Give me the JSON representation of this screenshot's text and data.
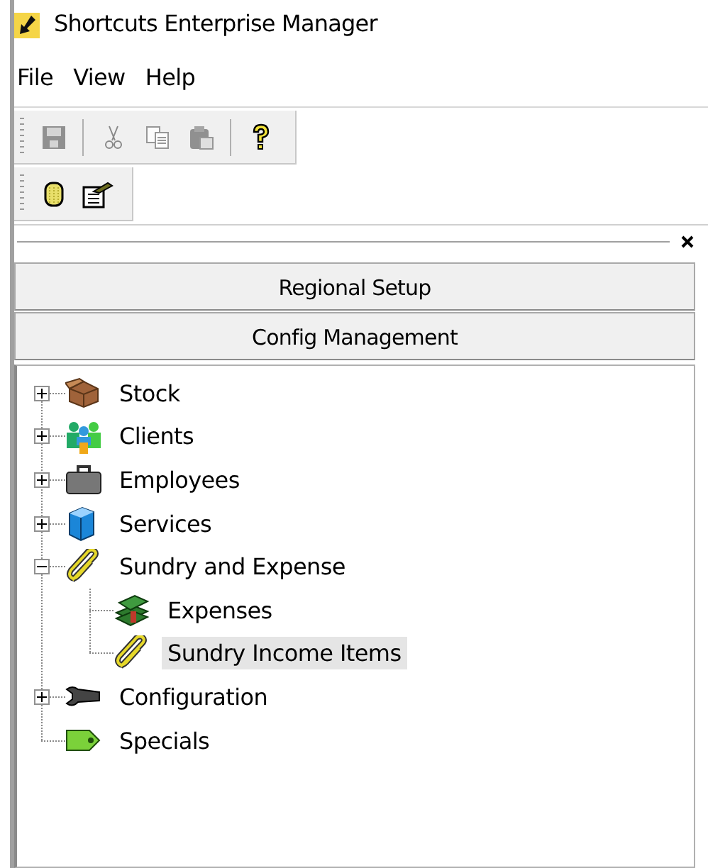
{
  "window": {
    "title": "Shortcuts Enterprise Manager"
  },
  "menu": [
    {
      "label": "File"
    },
    {
      "label": "View"
    },
    {
      "label": "Help"
    }
  ],
  "toolbars": [
    [
      {
        "kind": "button",
        "disabled": true
      },
      {
        "kind": "separator"
      },
      {
        "kind": "button",
        "disabled": true
      },
      {
        "kind": "button",
        "disabled": true
      },
      {
        "kind": "button",
        "disabled": true
      },
      {
        "kind": "separator"
      },
      {
        "kind": "button",
        "disabled": false
      }
    ],
    [
      {
        "kind": "button",
        "disabled": false
      },
      {
        "kind": "button",
        "disabled": false
      }
    ]
  ],
  "pane": {
    "sections": [
      {
        "label": "Regional Setup"
      },
      {
        "label": "Config Management"
      }
    ],
    "tree": [
      {
        "label": "Stock",
        "expanded": false,
        "selected": false
      },
      {
        "label": "Clients",
        "expanded": false,
        "selected": false
      },
      {
        "label": "Employees",
        "expanded": false,
        "selected": false
      },
      {
        "label": "Services",
        "expanded": false,
        "selected": false
      },
      {
        "label": "Sundry and Expense",
        "expanded": true,
        "selected": false,
        "children": [
          {
            "label": "Expenses",
            "selected": false
          },
          {
            "label": "Sundry Income Items",
            "selected": true
          }
        ]
      },
      {
        "label": "Configuration",
        "expanded": false,
        "selected": false
      },
      {
        "label": "Specials",
        "selected": false
      }
    ]
  }
}
